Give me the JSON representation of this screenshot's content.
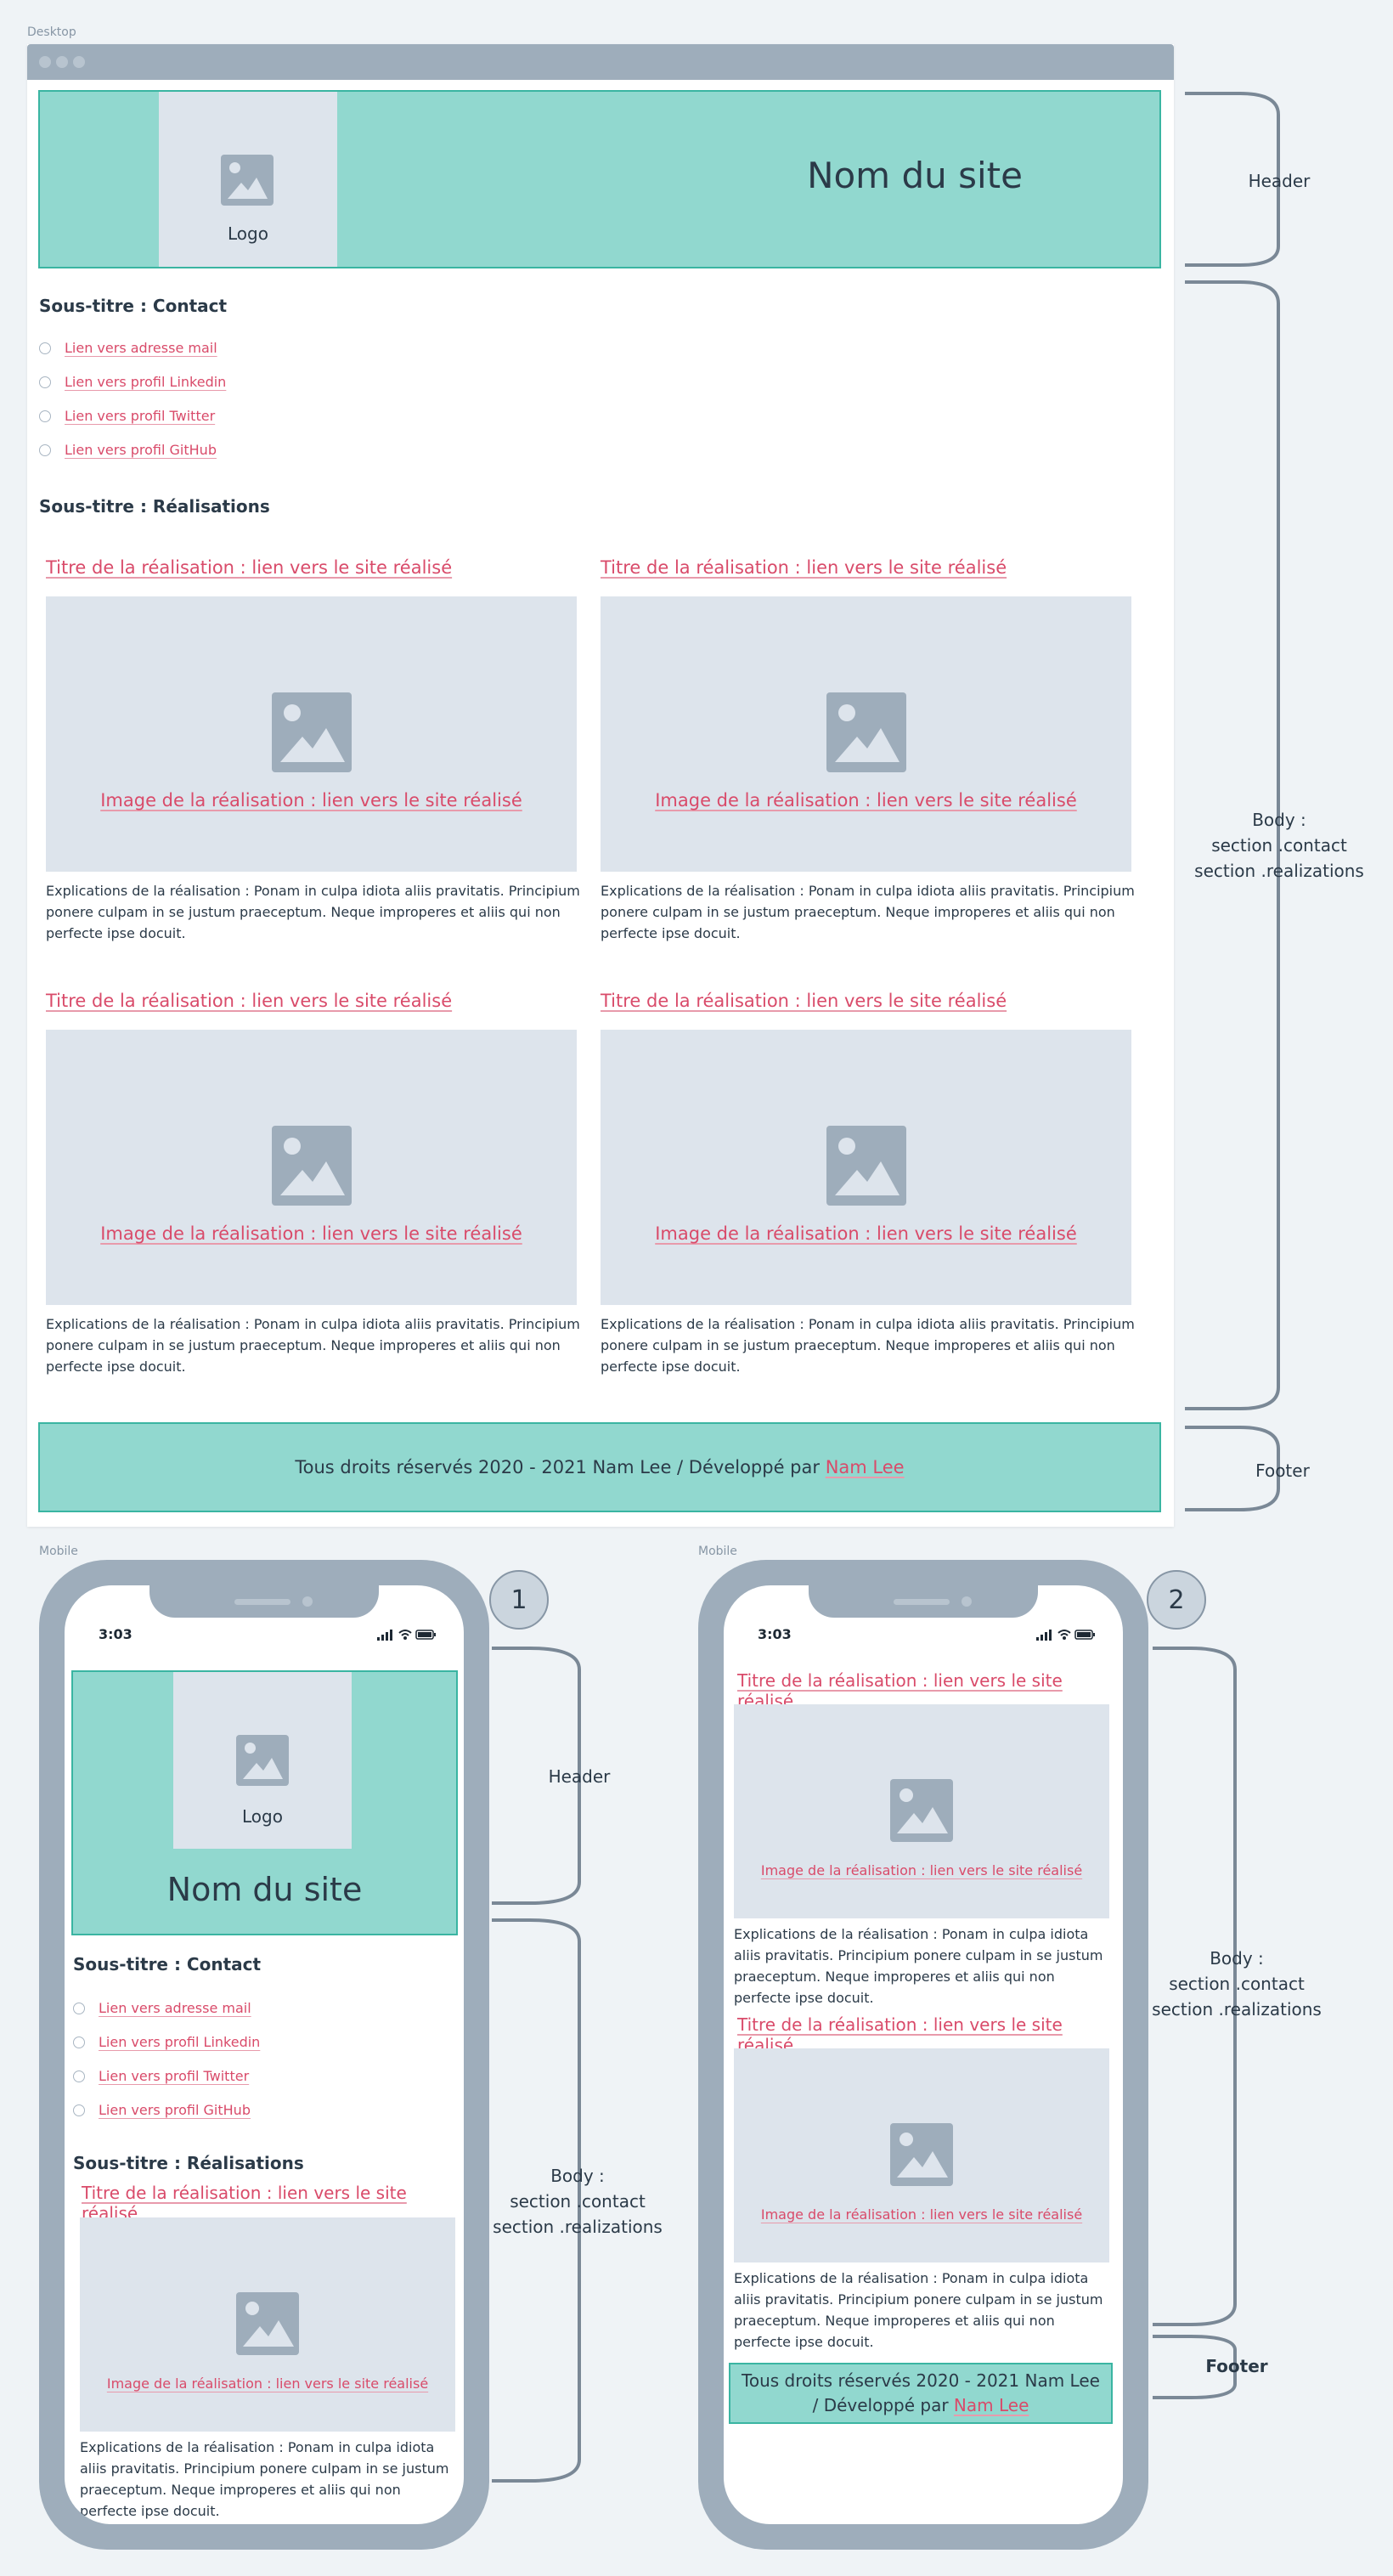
{
  "labels": {
    "desktop": "Desktop",
    "mobile_left": "Mobile",
    "mobile_right": "Mobile"
  },
  "site": {
    "logo": "Logo",
    "name": "Nom du site"
  },
  "contact": {
    "subtitle": "Sous-titre : Contact",
    "links": [
      "Lien vers adresse mail",
      "Lien vers profil Linkedin",
      "Lien vers profil Twitter",
      "Lien vers profil GitHub"
    ]
  },
  "realizations": {
    "subtitle": "Sous-titre : Réalisations",
    "title": "Titre de la réalisation : lien vers le site réalisé",
    "image": "Image de la réalisation : lien vers le site réalisé",
    "description": "Explications de la réalisation : Ponam in culpa idiota aliis pravitatis. Principium ponere culpam in se justum praeceptum. Neque improperes et aliis qui non perfecte ipse docuit."
  },
  "footer": {
    "text": "Tous droits réservés 2020 - 2021 Nam Lee / Développé par",
    "link": "Nam Lee",
    "line1": "Tous droits réservés 2020 - 2021 Nam Lee",
    "line2": "/ Développé par"
  },
  "annotations": {
    "header": "Header",
    "body_title": "Body :",
    "body_contact": "section .contact",
    "body_real": "section .realizations",
    "footer": "Footer"
  },
  "phone": {
    "time": "3:03",
    "badge1": "1",
    "badge2": "2"
  },
  "colors": {
    "accent": "#91d8cf",
    "accent_border": "#3ab5a2",
    "link": "#d94b6a",
    "placeholder": "#dde4ec",
    "frame": "#9eadbb"
  }
}
